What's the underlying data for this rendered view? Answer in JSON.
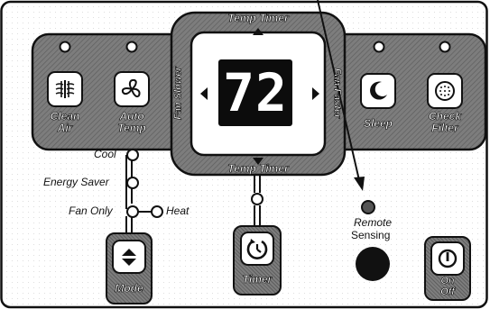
{
  "display": {
    "temperature": "72"
  },
  "dial": {
    "top_label": "Temp Timer",
    "bottom_label": "Temp Timer",
    "left_label": "Fan Slower",
    "right_label": "Fan Faster"
  },
  "buttons": {
    "clean_air": "Clean\nAir",
    "auto_temp": "Auto\nTemp",
    "sleep": "Sleep",
    "check_filter": "Check\nFilter",
    "mode": "Mode",
    "timer": "Timer",
    "on_off": "On\nOff"
  },
  "mode_options": {
    "cool": "Cool",
    "energy_saver": "Energy Saver",
    "fan_only": "Fan Only",
    "heat": "Heat"
  },
  "remote_sensing": {
    "line1": "Remote",
    "line2": "Sensing"
  },
  "colors": {
    "panel_gray": "#7a7a7a",
    "panel_border": "#111111",
    "display_bg": "#0c0c0c",
    "display_digits": "#ffffff",
    "sensor": "#111111"
  },
  "icons": {
    "clean_air": "air-filter-icon",
    "auto_temp": "fan-swirl-icon",
    "sleep": "crescent-moon-icon",
    "check_filter": "filter-mesh-icon",
    "mode": "up-down-arrows-icon",
    "timer": "clock-timer-icon",
    "on_off": "power-icon"
  }
}
